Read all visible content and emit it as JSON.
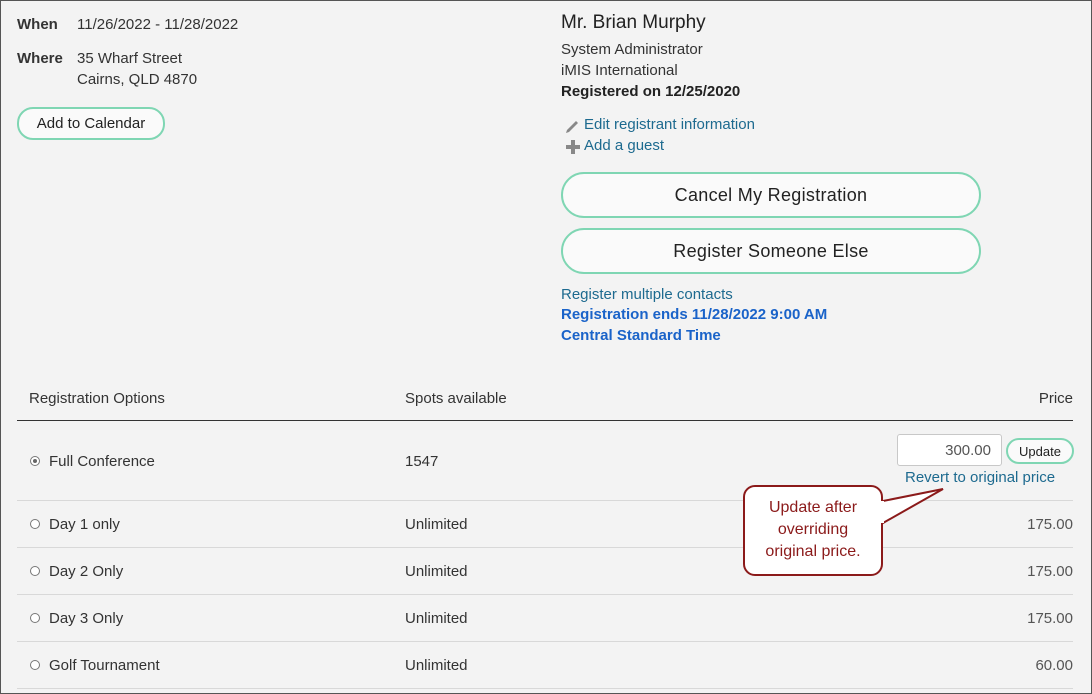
{
  "event": {
    "when_label": "When",
    "when_value": "11/26/2022 - 11/28/2022",
    "where_label": "Where",
    "where_line1": "35 Wharf Street",
    "where_line2": "Cairns, QLD 4870",
    "add_to_calendar": "Add to Calendar"
  },
  "registrant": {
    "name": "Mr. Brian Murphy",
    "title": "System Administrator",
    "org": "iMIS International",
    "registered_on": "Registered on 12/25/2020",
    "edit_link": "Edit registrant information",
    "add_guest_link": "Add a guest",
    "cancel_button": "Cancel My Registration",
    "register_else_button": "Register Someone Else",
    "register_multiple_link": "Register multiple contacts",
    "registration_ends": "Registration ends 11/28/2022 9:00 AM",
    "timezone": "Central Standard Time"
  },
  "table": {
    "headers": {
      "options": "Registration Options",
      "spots": "Spots available",
      "price": "Price"
    },
    "rows": [
      {
        "name": "Full Conference",
        "spots": "1547",
        "price": "300.00",
        "selected": true
      },
      {
        "name": "Day 1 only",
        "spots": "Unlimited",
        "price": "175.00",
        "selected": false
      },
      {
        "name": "Day 2 Only",
        "spots": "Unlimited",
        "price": "175.00",
        "selected": false
      },
      {
        "name": "Day 3 Only",
        "spots": "Unlimited",
        "price": "175.00",
        "selected": false
      },
      {
        "name": "Golf Tournament",
        "spots": "Unlimited",
        "price": "60.00",
        "selected": false
      }
    ],
    "update_button": "Update",
    "revert_link": "Revert to original price"
  },
  "callout": {
    "line1": "Update after",
    "line2": "overriding",
    "line3": "original price."
  },
  "icons": [
    "pencil-icon",
    "plus-icon",
    "radio-icon"
  ],
  "colors": {
    "accent_border": "#7fd6b3",
    "link": "#1d6a8f",
    "link_bold": "#1a63c9",
    "callout": "#8b1a1a"
  }
}
